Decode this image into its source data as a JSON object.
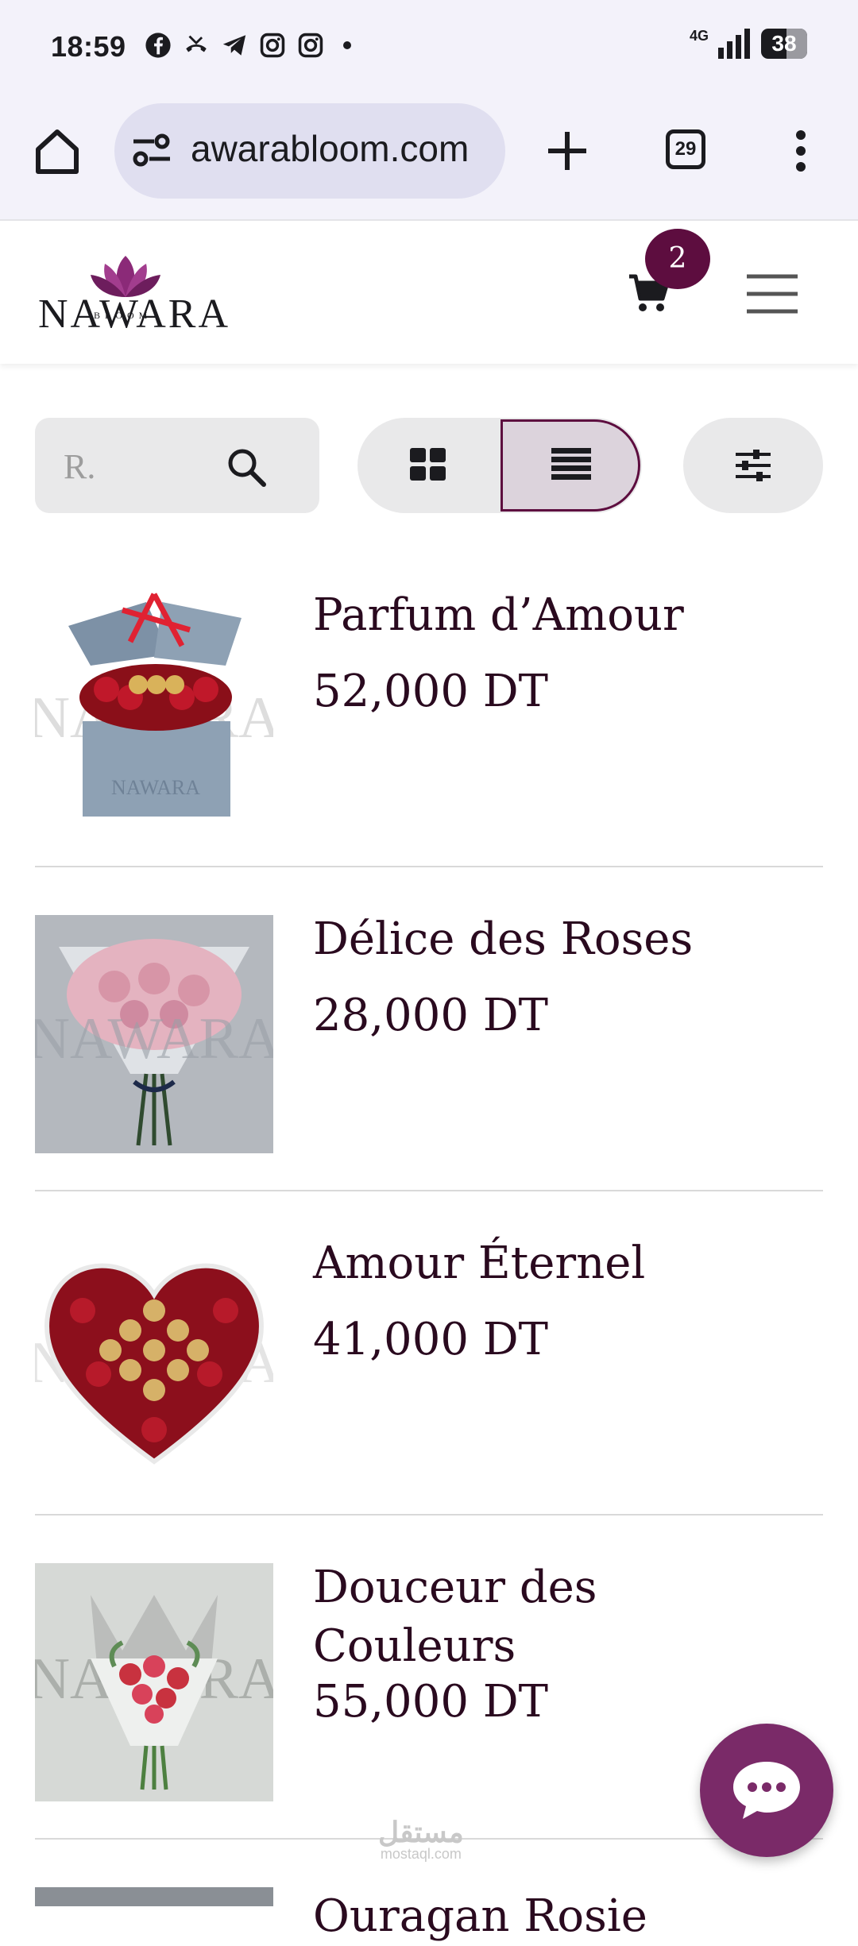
{
  "status_bar": {
    "time": "18:59",
    "network": "4G",
    "battery": "38",
    "notification_icons": [
      "facebook-icon",
      "missed-call-icon",
      "telegram-icon",
      "instagram-icon",
      "instagram-icon"
    ]
  },
  "browser": {
    "url": "awarabloom.com",
    "tab_count": "29"
  },
  "site": {
    "logo_text": "NAWARA",
    "logo_sub": "BLOOM",
    "cart_count": "2"
  },
  "toolbar": {
    "search_placeholder": "R.",
    "view_mode": "list"
  },
  "products": [
    {
      "name": "Parfum d’Amour",
      "price": "52,000 DT",
      "image": "gift-box-roses"
    },
    {
      "name": "Délice des Roses",
      "price": "28,000 DT",
      "image": "pink-bouquet"
    },
    {
      "name": "Amour Éternel",
      "price": "41,000 DT",
      "image": "heart-roses"
    },
    {
      "name": "Douceur des Couleurs",
      "price": "55,000 DT",
      "image": "rose-bouquet"
    },
    {
      "name": "Ouragan Rosie",
      "price": "",
      "image": "partial"
    }
  ],
  "watermark": {
    "text": "مستقل",
    "sub": "mostaql.com"
  },
  "colors": {
    "brand": "#5d0d3f",
    "chat": "#7a2a68",
    "text": "#2a0a1f"
  }
}
